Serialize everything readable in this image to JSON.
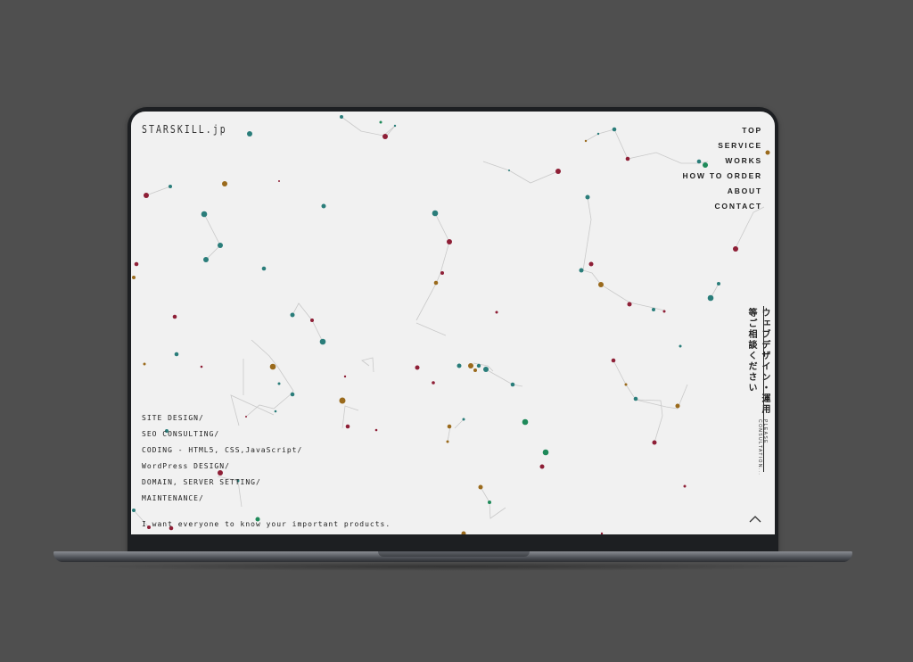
{
  "logo": "STARSKILL.jp",
  "nav": [
    "TOP",
    "SERVICE",
    "WORKS",
    "HOW TO ORDER",
    "ABOUT",
    "CONTACT"
  ],
  "services": [
    "SITE DESIGN/",
    "SEO CONSULTING/",
    "CODING - HTML5, CSS,JavaScript/",
    "WordPress DESIGN/",
    "DOMAIN, SERVER SETTING/",
    "MAINTENANCE/"
  ],
  "tagline": "I want everyone to know your important products.",
  "vertical_jp": "ウェブデザイン・運用等ご相談ください",
  "vertical_en": "PLEASE CONSULTATION...",
  "colors": {
    "teal": "#2a7d7a",
    "red": "#8e1f36",
    "gold": "#9a6a1c",
    "green": "#1f8a5a",
    "background": "#f1f1f1",
    "bezel": "#1d1f22",
    "desk": "#4f4f4f"
  },
  "icons": {
    "scroll_top": "chevron-up-icon"
  }
}
